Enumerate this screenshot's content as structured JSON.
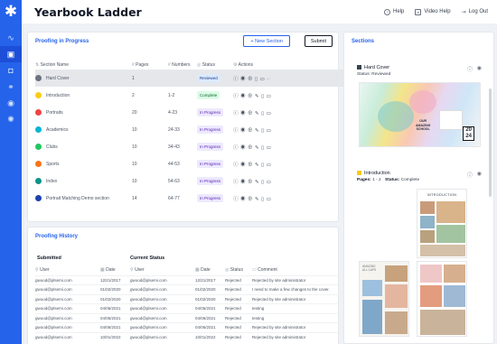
{
  "app": {
    "title": "Yearbook Ladder"
  },
  "top_links": [
    {
      "icon": "help-circle-icon",
      "label": "Help"
    },
    {
      "icon": "video-icon",
      "label": "Video Help"
    },
    {
      "icon": "logout-icon",
      "label": "Log Out"
    }
  ],
  "proofing": {
    "title": "Proofing in Progress",
    "new_section_label": "+ New Section",
    "submit_label": "Submit",
    "columns": {
      "section": "Section Name",
      "pages": "Pages",
      "numbers": "Numbers",
      "status": "Status",
      "actions": "Actions"
    },
    "rows": [
      {
        "name": "Hard Cover",
        "pages": "1",
        "numbers": "",
        "status": "Reviewed",
        "color": "#6b7280"
      },
      {
        "name": "Introduction",
        "pages": "2",
        "numbers": "1-2",
        "status": "Complete",
        "color": "#facc15"
      },
      {
        "name": "Portraits",
        "pages": "20",
        "numbers": "4-23",
        "status": "In Progress",
        "color": "#ef4444"
      },
      {
        "name": "Academics",
        "pages": "10",
        "numbers": "24-33",
        "status": "In Progress",
        "color": "#06b6d4"
      },
      {
        "name": "Clubs",
        "pages": "10",
        "numbers": "34-43",
        "status": "In Progress",
        "color": "#22c55e"
      },
      {
        "name": "Sports",
        "pages": "10",
        "numbers": "44-53",
        "status": "In Progress",
        "color": "#f97316"
      },
      {
        "name": "Index",
        "pages": "10",
        "numbers": "54-63",
        "status": "In Progress",
        "color": "#0d9488"
      },
      {
        "name": "Portrait Matching Demo section",
        "pages": "14",
        "numbers": "64-77",
        "status": "In Progress",
        "color": "#1e40af"
      }
    ]
  },
  "history": {
    "title": "Proofing History",
    "group_submitted": "Submitted",
    "group_current": "Current Status",
    "columns": {
      "user": "User",
      "date": "Date",
      "status": "Status",
      "comment": "Comment"
    },
    "rows": [
      {
        "user": "gwood@plsemi.com",
        "date": "12/21/2017",
        "cuser": "gwood@plsemi.com",
        "cdate": "12/21/2017",
        "status": "Rejected",
        "comment": "Rejected by site administrator"
      },
      {
        "user": "gwood@plsemi.com",
        "date": "01/02/2020",
        "cuser": "gwood@plsemi.com",
        "cdate": "01/02/2020",
        "status": "Rejected",
        "comment": "I need to make a few changes to the cover."
      },
      {
        "user": "gwood@plsemi.com",
        "date": "01/02/2020",
        "cuser": "gwood@plsemi.com",
        "cdate": "01/02/2020",
        "status": "Rejected",
        "comment": "Rejected by site administrator"
      },
      {
        "user": "gwood@plsemi.com",
        "date": "04/06/2021",
        "cuser": "gwood@plsemi.com",
        "cdate": "04/06/2021",
        "status": "Rejected",
        "comment": "testing"
      },
      {
        "user": "gwood@plsemi.com",
        "date": "04/06/2021",
        "cuser": "gwood@plsemi.com",
        "cdate": "04/06/2021",
        "status": "Rejected",
        "comment": "testing"
      },
      {
        "user": "gwood@plsemi.com",
        "date": "04/06/2021",
        "cuser": "gwood@plsemi.com",
        "cdate": "04/06/2021",
        "status": "Rejected",
        "comment": "Rejected by site administrator"
      },
      {
        "user": "gwood@plsemi.com",
        "date": "10/01/2022",
        "cuser": "gwood@plsemi.com",
        "cdate": "10/01/2022",
        "status": "Rejected",
        "comment": "Rejected by site administrator"
      }
    ]
  },
  "sections_panel": {
    "title": "Sections",
    "cards": [
      {
        "name": "Hard Cover",
        "meta_label": "Status:",
        "meta_value": "Reviewed",
        "color": "#374151"
      },
      {
        "name": "Introduction",
        "pages_label": "Pages:",
        "pages_value": "1 - 2",
        "meta_label": "Status:",
        "meta_value": "Complete",
        "color": "#facc15"
      }
    ],
    "cover_text": {
      "line1": "OUR",
      "line2": "AMAZING",
      "line3": "SCHOOL",
      "year1": "20",
      "year2": "24"
    },
    "intro_title": "INTRODUCTION",
    "left_page_text": "AMAZING\nALL CAPS"
  }
}
